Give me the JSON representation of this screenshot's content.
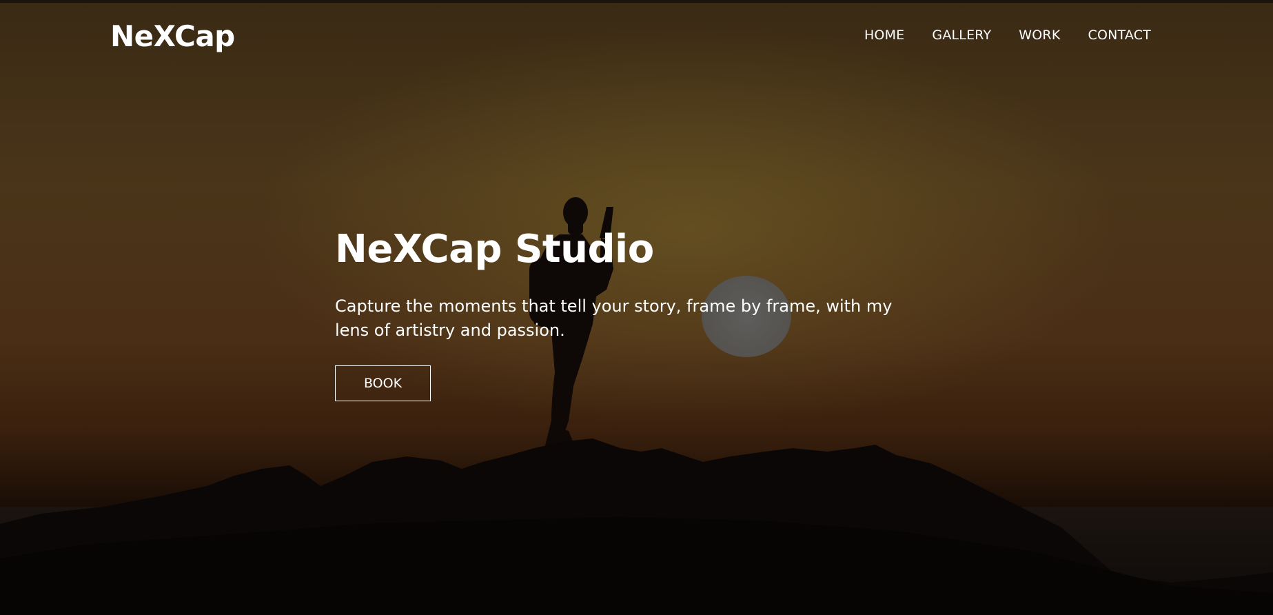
{
  "site": {
    "logo_text": "NeXCap"
  },
  "nav": {
    "items": [
      {
        "label": "HOME"
      },
      {
        "label": "GALLERY"
      },
      {
        "label": "WORK"
      },
      {
        "label": "CONTACT"
      }
    ]
  },
  "hero": {
    "title": "NeXCap Studio",
    "subtitle": "Capture the moments that tell your story, frame by frame, with my lens of artistry and passion.",
    "cta_label": "BOOK"
  },
  "colors": {
    "text": "#ffffff",
    "sky_top": "#3a2a14",
    "sky_mid": "#4a3519",
    "rocks": "#0a0706"
  }
}
